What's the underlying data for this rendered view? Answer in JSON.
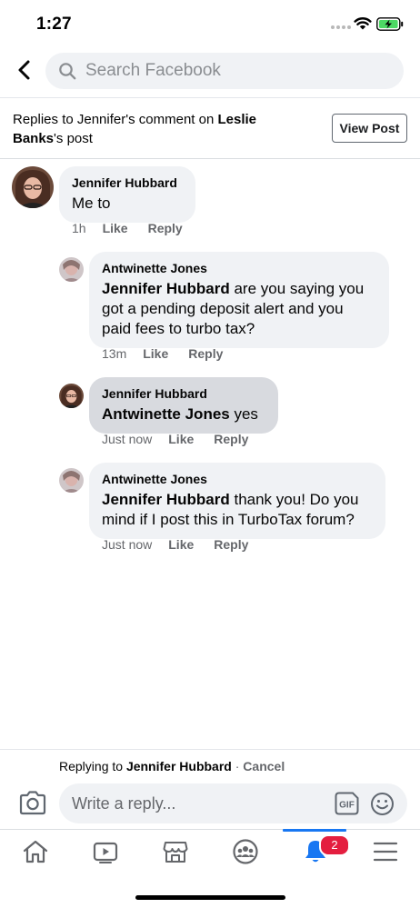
{
  "status_bar": {
    "time": "1:27"
  },
  "search": {
    "placeholder": "Search Facebook",
    "value": ""
  },
  "context": {
    "prefix": "Replies to Jennifer's comment on ",
    "post_owner": "Leslie Banks",
    "suffix": "'s post",
    "view_post_label": "View Post"
  },
  "comments": [
    {
      "author": "Jennifer Hubbard",
      "mention": "",
      "text": "Me to",
      "time": "1h",
      "like": "Like",
      "reply": "Reply"
    },
    {
      "author": "Antwinette Jones",
      "mention": "Jennifer Hubbard",
      "text": " are you saying you got a pending deposit alert and you paid fees to turbo tax?",
      "time": "13m",
      "like": "Like",
      "reply": "Reply"
    },
    {
      "author": "Jennifer Hubbard",
      "mention": "Antwinette Jones",
      "text": " yes",
      "time": "Just now",
      "like": "Like",
      "reply": "Reply",
      "highlighted": true
    },
    {
      "author": "Antwinette Jones",
      "mention": "Jennifer Hubbard",
      "text": " thank you! Do you mind if I post this in TurboTax forum?",
      "time": "Just now",
      "like": "Like",
      "reply": "Reply"
    }
  ],
  "reply_bar": {
    "replying_prefix": "Replying to ",
    "replying_name": "Jennifer Hubbard",
    "separator": " · ",
    "cancel_label": "Cancel",
    "placeholder": "Write a reply...",
    "value": ""
  },
  "tab_bar": {
    "tabs": [
      "home-icon",
      "watch-icon",
      "marketplace-icon",
      "groups-icon",
      "notifications-icon",
      "menu-icon"
    ],
    "active": "notifications-icon",
    "notification_count": "2"
  },
  "colors": {
    "accent": "#1877f2",
    "badge": "#e41e3f",
    "bubble": "#f0f2f5",
    "bubble_highlight": "#d8dadf",
    "battery": "#4cd964"
  }
}
